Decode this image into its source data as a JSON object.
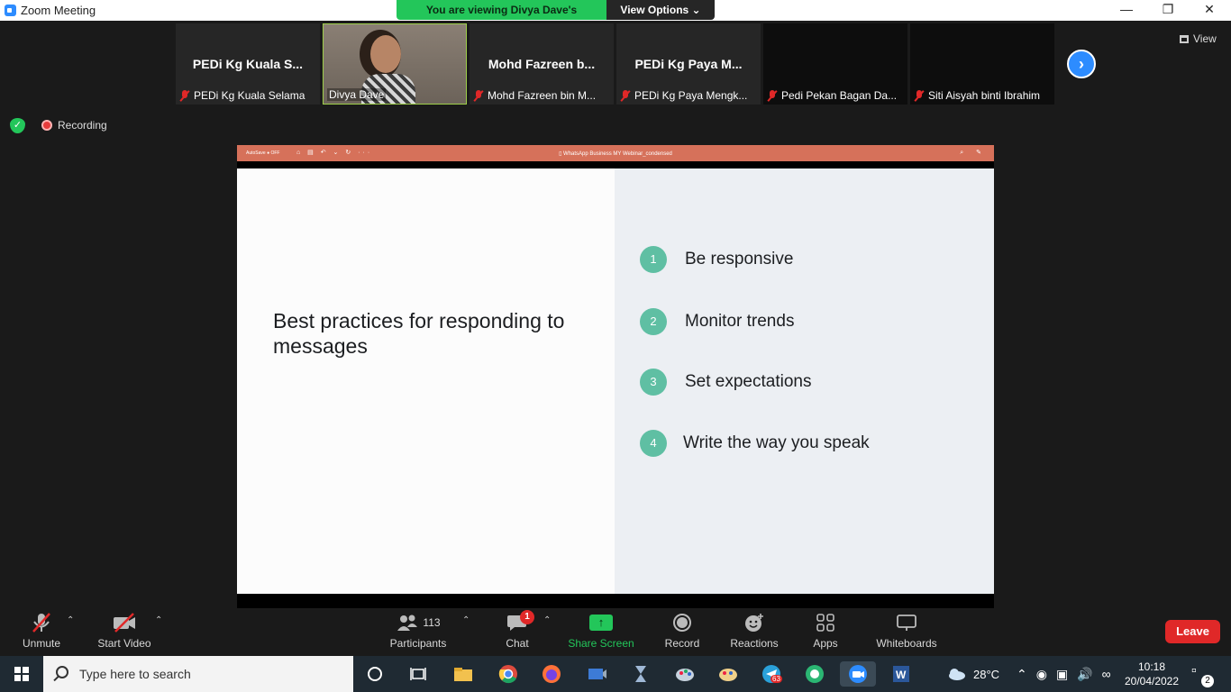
{
  "window": {
    "title": "Zoom Meeting",
    "minimize_icon": "minimize-icon",
    "maximize_icon": "restore-icon",
    "close_icon": "close-icon"
  },
  "banner": {
    "message": "You are viewing Divya Dave's screen",
    "view_options": "View Options ⌄"
  },
  "gallery": {
    "tiles": [
      {
        "big_name": "PEDi Kg Kuala S...",
        "name": "PEDi Kg Kuala Selama",
        "muted": true,
        "video": false
      },
      {
        "big_name": "",
        "name": "Divya Dave",
        "muted": false,
        "video": true
      },
      {
        "big_name": "Mohd Fazreen b...",
        "name": "Mohd Fazreen bin M...",
        "muted": true,
        "video": false
      },
      {
        "big_name": "PEDi Kg Paya M...",
        "name": "PEDi Kg Paya Mengk...",
        "muted": true,
        "video": false
      },
      {
        "big_name": "",
        "name": "Pedi Pekan Bagan Da...",
        "muted": true,
        "video": false
      },
      {
        "big_name": "",
        "name": "Siti Aisyah binti Ibrahim",
        "muted": true,
        "video": false
      }
    ],
    "next_arrow": "›",
    "view_label": "View"
  },
  "status": {
    "recording_label": "Recording"
  },
  "shared_screen": {
    "autosave": "AutoSave ● OFF",
    "tools": "⌂ ▤ ↶ ⌄ ↻ ···",
    "document_title": "▯ WhatsApp Business MY Webinar_condensed",
    "right_tools": "⌕ ✎",
    "slide": {
      "heading": "Best practices for responding to messages",
      "bullets": [
        {
          "num": "1",
          "text": "Be responsive"
        },
        {
          "num": "2",
          "text": "Monitor trends"
        },
        {
          "num": "3",
          "text": "Set expectations"
        },
        {
          "num": "4",
          "text": "Write the way you speak"
        }
      ]
    },
    "colors": {
      "header": "#d6715a",
      "bullet": "#5fbfa3",
      "right_pane": "#eceff3"
    }
  },
  "toolbar": {
    "unmute": "Unmute",
    "start_video": "Start Video",
    "participants": "Participants",
    "participant_count": "113",
    "chat": "Chat",
    "chat_badge": "1",
    "share_screen": "Share Screen",
    "record": "Record",
    "reactions": "Reactions",
    "apps": "Apps",
    "whiteboards": "Whiteboards",
    "leave": "Leave"
  },
  "taskbar": {
    "search_placeholder": "Type here to search",
    "weather": "28°C",
    "time": "10:18",
    "date": "20/04/2022",
    "notifications": "2",
    "telegram_badge": "63"
  }
}
